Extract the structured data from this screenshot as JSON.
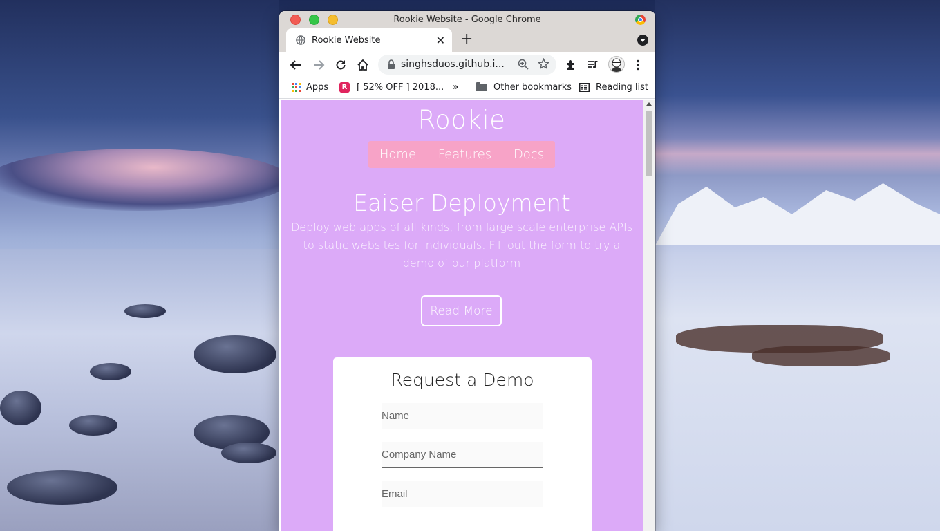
{
  "window": {
    "title": "Rookie Website - Google Chrome"
  },
  "tabs": [
    {
      "label": "Rookie Website",
      "icon": "globe-icon",
      "active": true
    }
  ],
  "toolbar": {
    "url": "singhsduos.github.i...",
    "icons": [
      "back-icon",
      "forward-icon",
      "reload-icon",
      "home-icon",
      "lock-icon",
      "zoom-icon",
      "star-icon",
      "extensions-icon",
      "media-icon",
      "avatar",
      "menu-icon"
    ]
  },
  "bookmarks": {
    "apps_label": "Apps",
    "item1_label": "[ 52% OFF ] 2018...",
    "overflow_label": "»",
    "other_label": "Other bookmarks",
    "reading_list_label": "Reading list"
  },
  "page": {
    "site_title": "Rookie",
    "nav": [
      "Home",
      "Features",
      "Docs"
    ],
    "hero_title": "Eaiser Deployment",
    "hero_text": "Deploy web apps of all kinds, from large scale enterprise APIs to static websites for individuals. Fill out the form to try a demo of our platform",
    "read_more": "Read More",
    "form": {
      "title": "Request a Demo",
      "fields": [
        {
          "placeholder": "Name",
          "value": ""
        },
        {
          "placeholder": "Company Name",
          "value": ""
        },
        {
          "placeholder": "Email",
          "value": ""
        }
      ]
    }
  },
  "colors": {
    "page_bg": "#dcaaf8",
    "nav_bg": "#f7a3c7",
    "card_bg": "#ffffff"
  }
}
